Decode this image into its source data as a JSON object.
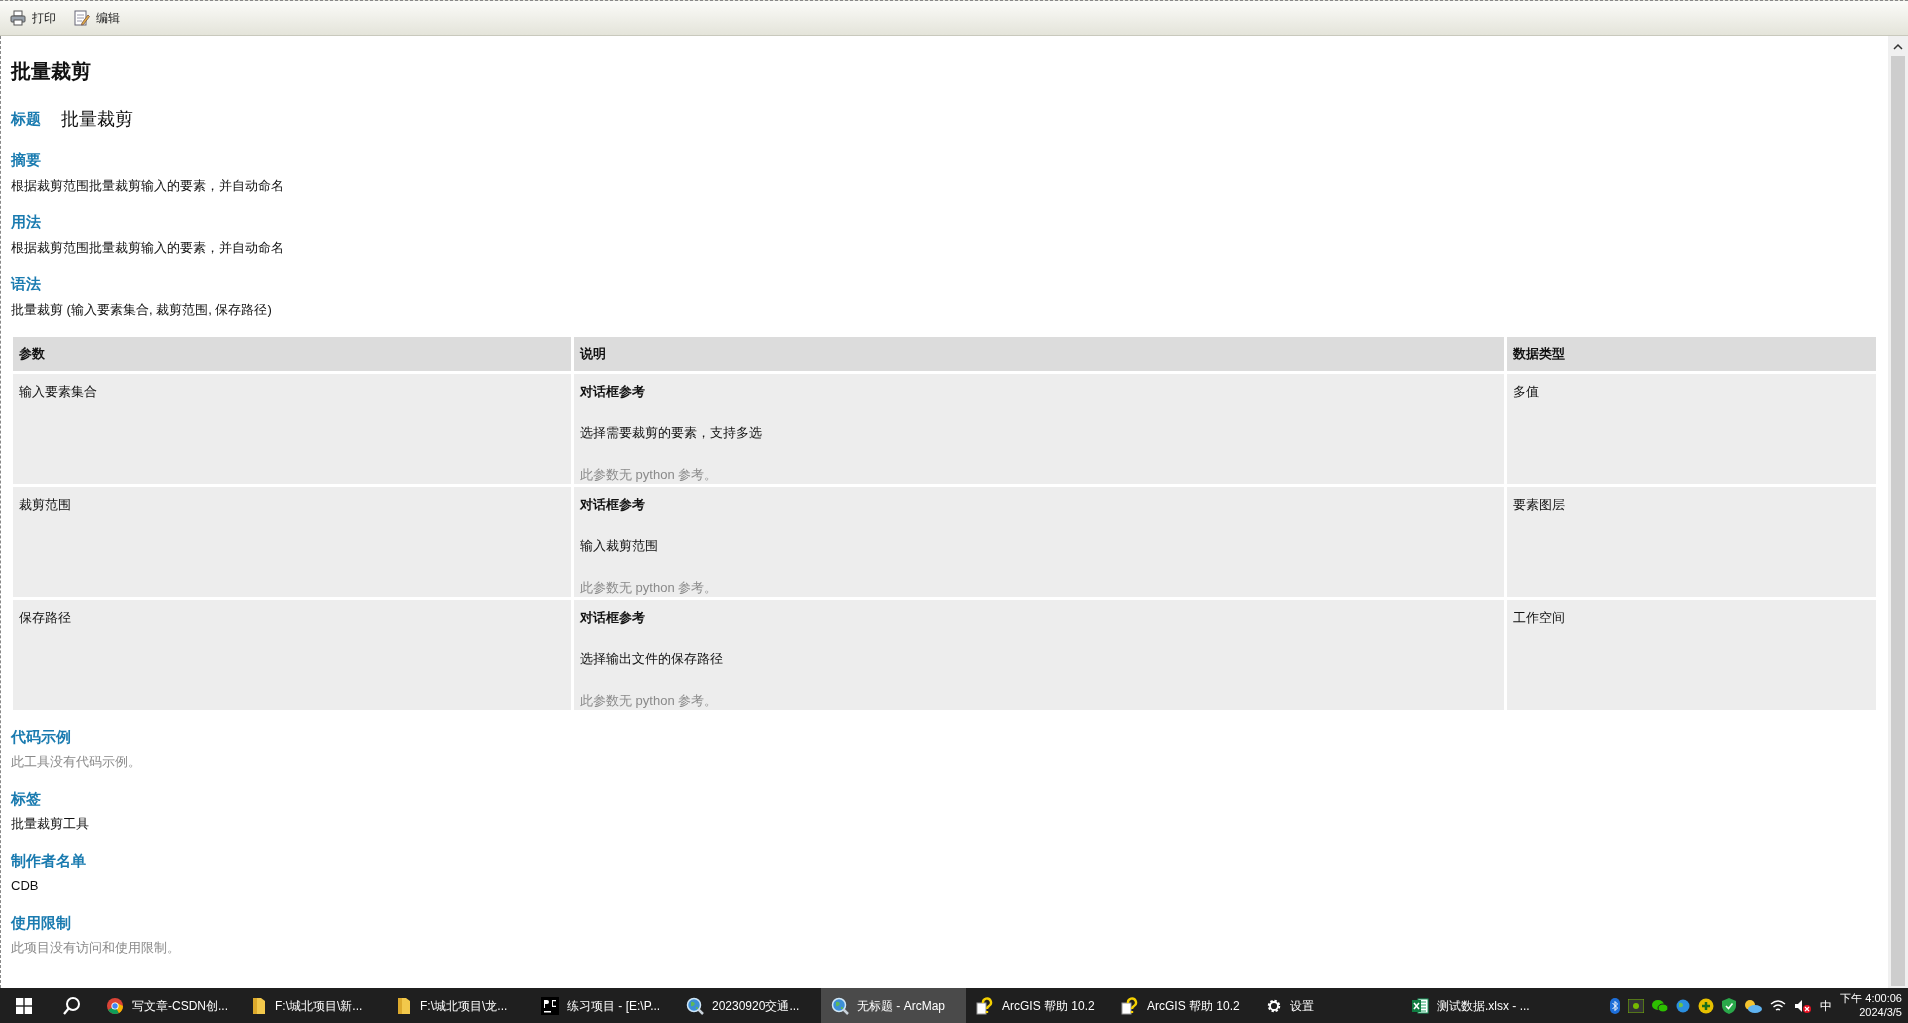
{
  "toolbar": [
    {
      "kind": "print",
      "label": "打印"
    },
    {
      "kind": "edit",
      "label": "编辑"
    }
  ],
  "page_title": "批量裁剪",
  "title_field": {
    "label": "标题",
    "value": "批量裁剪"
  },
  "sections": [
    {
      "kind": "text",
      "heading": "摘要",
      "text": "根据裁剪范围批量裁剪输入的要素，并自动命名",
      "muted": false
    },
    {
      "kind": "text",
      "heading": "用法",
      "text": "根据裁剪范围批量裁剪输入的要素，并自动命名",
      "muted": false
    },
    {
      "kind": "text",
      "heading": "语法",
      "text": "批量裁剪 (输入要素集合, 裁剪范围, 保存路径)",
      "muted": false
    },
    {
      "kind": "table",
      "columns": [
        "参数",
        "说明",
        "数据类型"
      ],
      "rows": [
        {
          "name": "输入要素集合",
          "ref": "对话框参考",
          "description": "选择需要裁剪的要素，支持多选",
          "note": "此参数无 python 参考。",
          "type": "多值"
        },
        {
          "name": "裁剪范围",
          "ref": "对话框参考",
          "description": "输入裁剪范围",
          "note": "此参数无 python 参考。",
          "type": "要素图层"
        },
        {
          "name": "保存路径",
          "ref": "对话框参考",
          "description": "选择输出文件的保存路径",
          "note": "此参数无 python 参考。",
          "type": "工作空间"
        }
      ]
    },
    {
      "kind": "text",
      "heading": "代码示例",
      "text": "此工具没有代码示例。",
      "muted": true
    },
    {
      "kind": "text",
      "heading": "标签",
      "text": "批量裁剪工具",
      "muted": false
    },
    {
      "kind": "text",
      "heading": "制作者名单",
      "text": "CDB",
      "muted": false
    },
    {
      "kind": "text",
      "heading": "使用限制",
      "text": "此项目没有访问和使用限制。",
      "muted": true
    }
  ],
  "taskbar": {
    "apps": [
      {
        "kind": "chrome",
        "label": "写文章-CSDN创...",
        "selected": false
      },
      {
        "kind": "folder",
        "label": "F:\\城北项目\\新...",
        "selected": false
      },
      {
        "kind": "folder",
        "label": "F:\\城北项目\\龙...",
        "selected": false
      },
      {
        "kind": "pycharm",
        "label": "练习项目 - [E:\\P...",
        "selected": false
      },
      {
        "kind": "globe",
        "label": "20230920交通...",
        "selected": false
      },
      {
        "kind": "globe",
        "label": "无标题 - ArcMap",
        "selected": true
      },
      {
        "kind": "help",
        "label": "ArcGIS 帮助 10.2",
        "selected": false
      },
      {
        "kind": "help",
        "label": "ArcGIS 帮助 10.2",
        "selected": false
      },
      {
        "kind": "gear",
        "label": "设置",
        "selected": false
      },
      {
        "kind": "excel",
        "label": "测试数据.xlsx - ...",
        "selected": false
      }
    ],
    "input_method": "中",
    "time": "下午 4:00:06",
    "date": "2024/3/5"
  }
}
